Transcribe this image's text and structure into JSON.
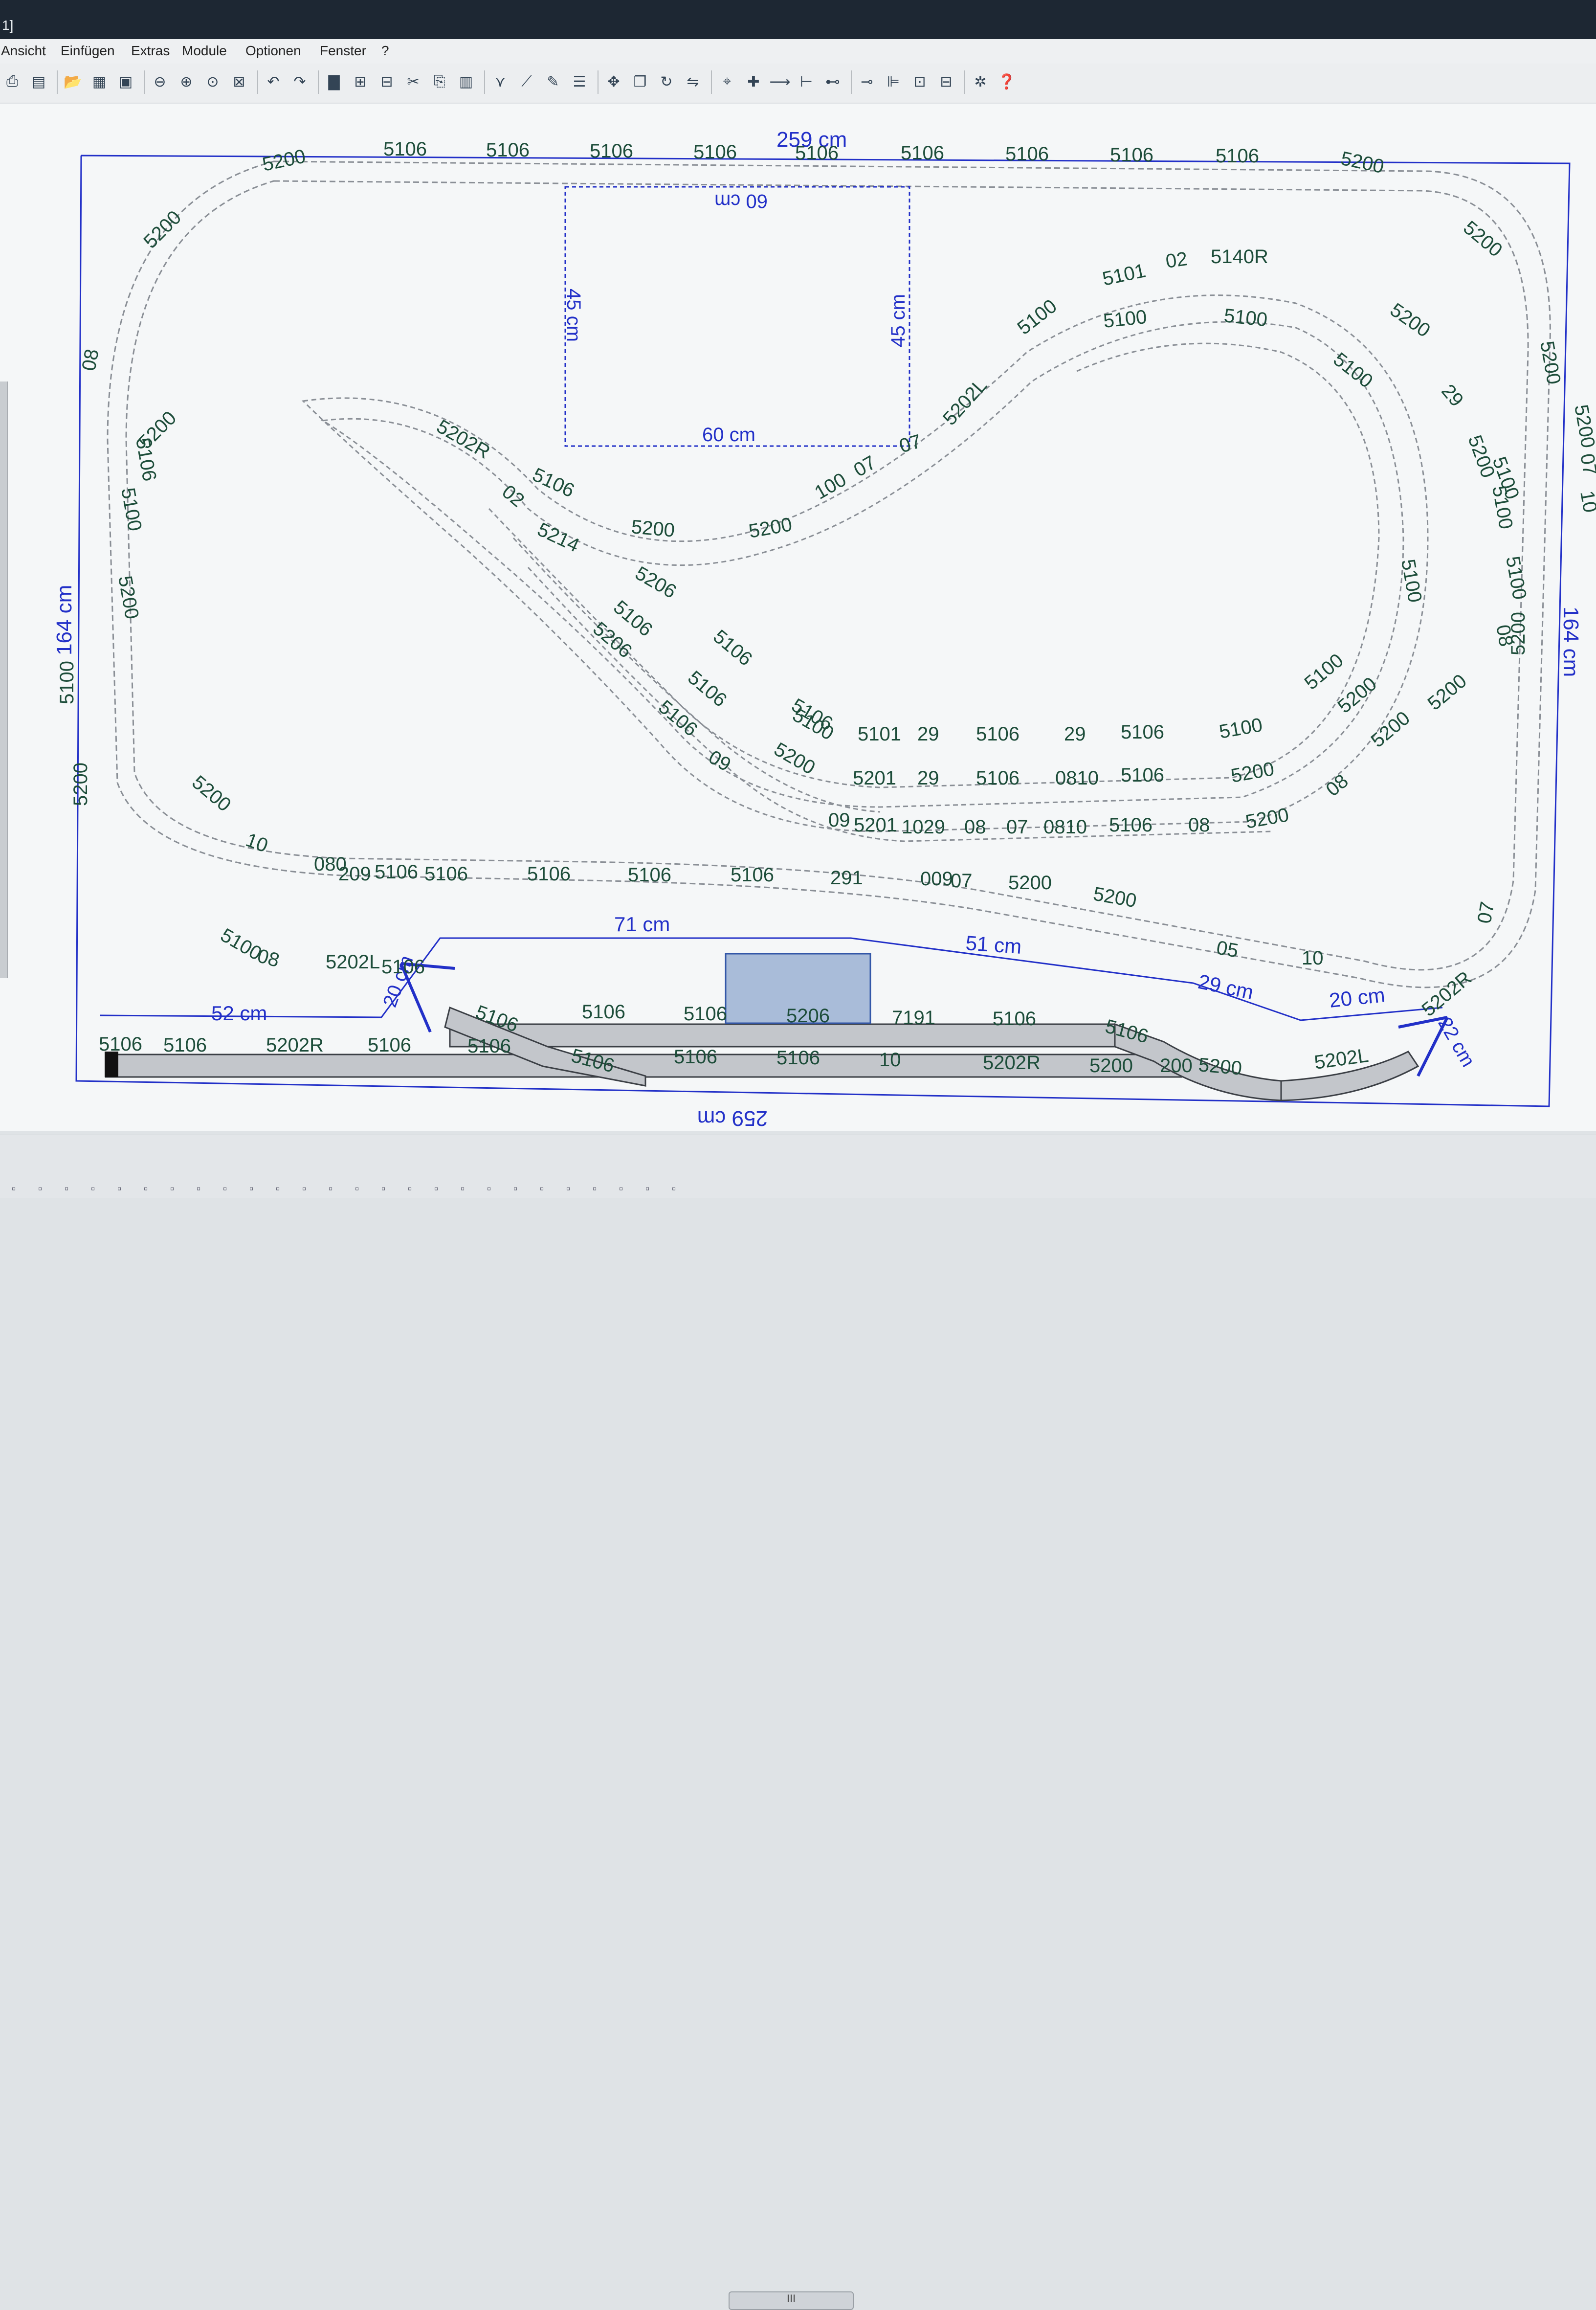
{
  "window": {
    "title": "1]"
  },
  "menu": [
    "Ansicht",
    "Einfügen",
    "Extras",
    "Module",
    "Optionen",
    "Fenster",
    "?"
  ],
  "toolbar_icons": [
    "print-icon",
    "preview-icon",
    "open-icon",
    "table-icon",
    "image-icon",
    "zoom-out-icon",
    "zoom-in-icon",
    "zoom-window-icon",
    "zoom-fit-icon",
    "undo-icon",
    "redo-icon",
    "doc-icon",
    "grid-icon",
    "grid2-icon",
    "cut-icon",
    "copy-icon",
    "paste-icon",
    "filter-icon",
    "pen-icon",
    "edit-icon",
    "layers-icon",
    "move-icon",
    "duplicate-icon",
    "rotate-icon",
    "flip-icon",
    "snap-icon",
    "add-icon",
    "track-icon",
    "measure-icon",
    "connect-icon",
    "split-icon",
    "align-icon",
    "group-icon",
    "ungroup-icon",
    "settings-icon",
    "help-icon"
  ],
  "layout": {
    "dimensions": {
      "top_width": "259 cm",
      "bottom_width": "259 cm",
      "left_height": "164 cm",
      "right_height": "164 cm",
      "box_top": "60 cm",
      "box_bottom": "60 cm",
      "box_left": "45 cm",
      "box_right": "45 cm",
      "platform_71": "71 cm",
      "platform_51": "51 cm",
      "platform_29": "29 cm",
      "platform_20": "20 cm",
      "platform_52": "52 cm",
      "bracket_left": "20 cm",
      "bracket_right": "22 cm"
    },
    "track_labels": [
      "5200",
      "5106",
      "5106",
      "5106",
      "5106",
      "5106",
      "5106",
      "5106",
      "5106",
      "5106",
      "5200",
      "5200",
      "5200",
      "5200",
      "5101",
      "02",
      "5140R",
      "5100",
      "5100",
      "5100",
      "5200",
      "5100",
      "5200",
      "29",
      "5100",
      "07",
      "10",
      "5100",
      "5200",
      "5202L",
      "07",
      "5100",
      "5100",
      "5202R",
      "5106",
      "02",
      "5214",
      "5200",
      "5200",
      "100",
      "07",
      "5206",
      "5106",
      "5106",
      "5206",
      "5106",
      "5106",
      "5106",
      "5100",
      "5101",
      "29",
      "5106",
      "29",
      "5106",
      "5100",
      "5100",
      "09",
      "5200",
      "5201",
      "29",
      "5106",
      "0810",
      "5106",
      "5200",
      "5200",
      "5200",
      "09",
      "5201",
      "1029",
      "08",
      "07",
      "0810",
      "5106",
      "08",
      "5200",
      "08",
      "5200",
      "5200",
      "5200",
      "10",
      "080",
      "209",
      "5106",
      "5106",
      "5106",
      "5106",
      "5106",
      "291",
      "009",
      "07",
      "5200",
      "5200",
      "05",
      "10",
      "5100",
      "08",
      "5202L",
      "5106",
      "5106",
      "5106",
      "5106",
      "5206",
      "7191",
      "5106",
      "5106",
      "5106",
      "5106",
      "5202R",
      "5106",
      "5106",
      "5106",
      "5106",
      "5106",
      "10",
      "5202R",
      "5200",
      "200",
      "5200",
      "5202L",
      "5202R",
      "07",
      "5100",
      "5200",
      "5100",
      "5200",
      "08",
      "5106",
      "08",
      "5200"
    ]
  },
  "status": {
    "scroll_label": "III"
  }
}
